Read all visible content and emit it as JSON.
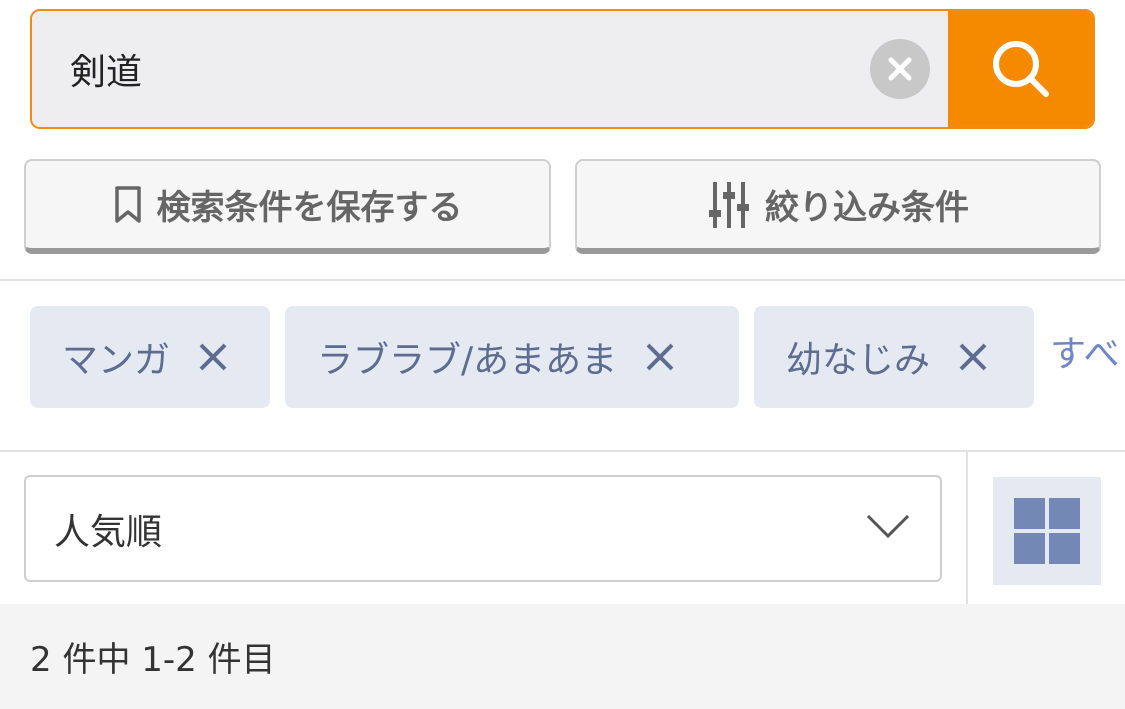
{
  "search": {
    "value": "剣道",
    "clear_icon": "clear-circle-icon",
    "search_icon": "search-icon",
    "accent_color": "#f58a00"
  },
  "actions": {
    "save_label": "検索条件を保存する",
    "save_icon": "bookmark-icon",
    "filter_label": "絞り込み条件",
    "filter_icon": "sliders-icon"
  },
  "tags": {
    "items": [
      {
        "label": "マンガ"
      },
      {
        "label": "ラブラブ/あまあま"
      },
      {
        "label": "幼なじみ"
      }
    ],
    "clear_all_label": "すべ",
    "remove_icon": "close-icon"
  },
  "sort": {
    "selected": "人気順",
    "dropdown_icon": "chevron-down-icon"
  },
  "view": {
    "toggle_icon": "grid-view-icon"
  },
  "results": {
    "summary": "2 件中 1-2 件目"
  }
}
